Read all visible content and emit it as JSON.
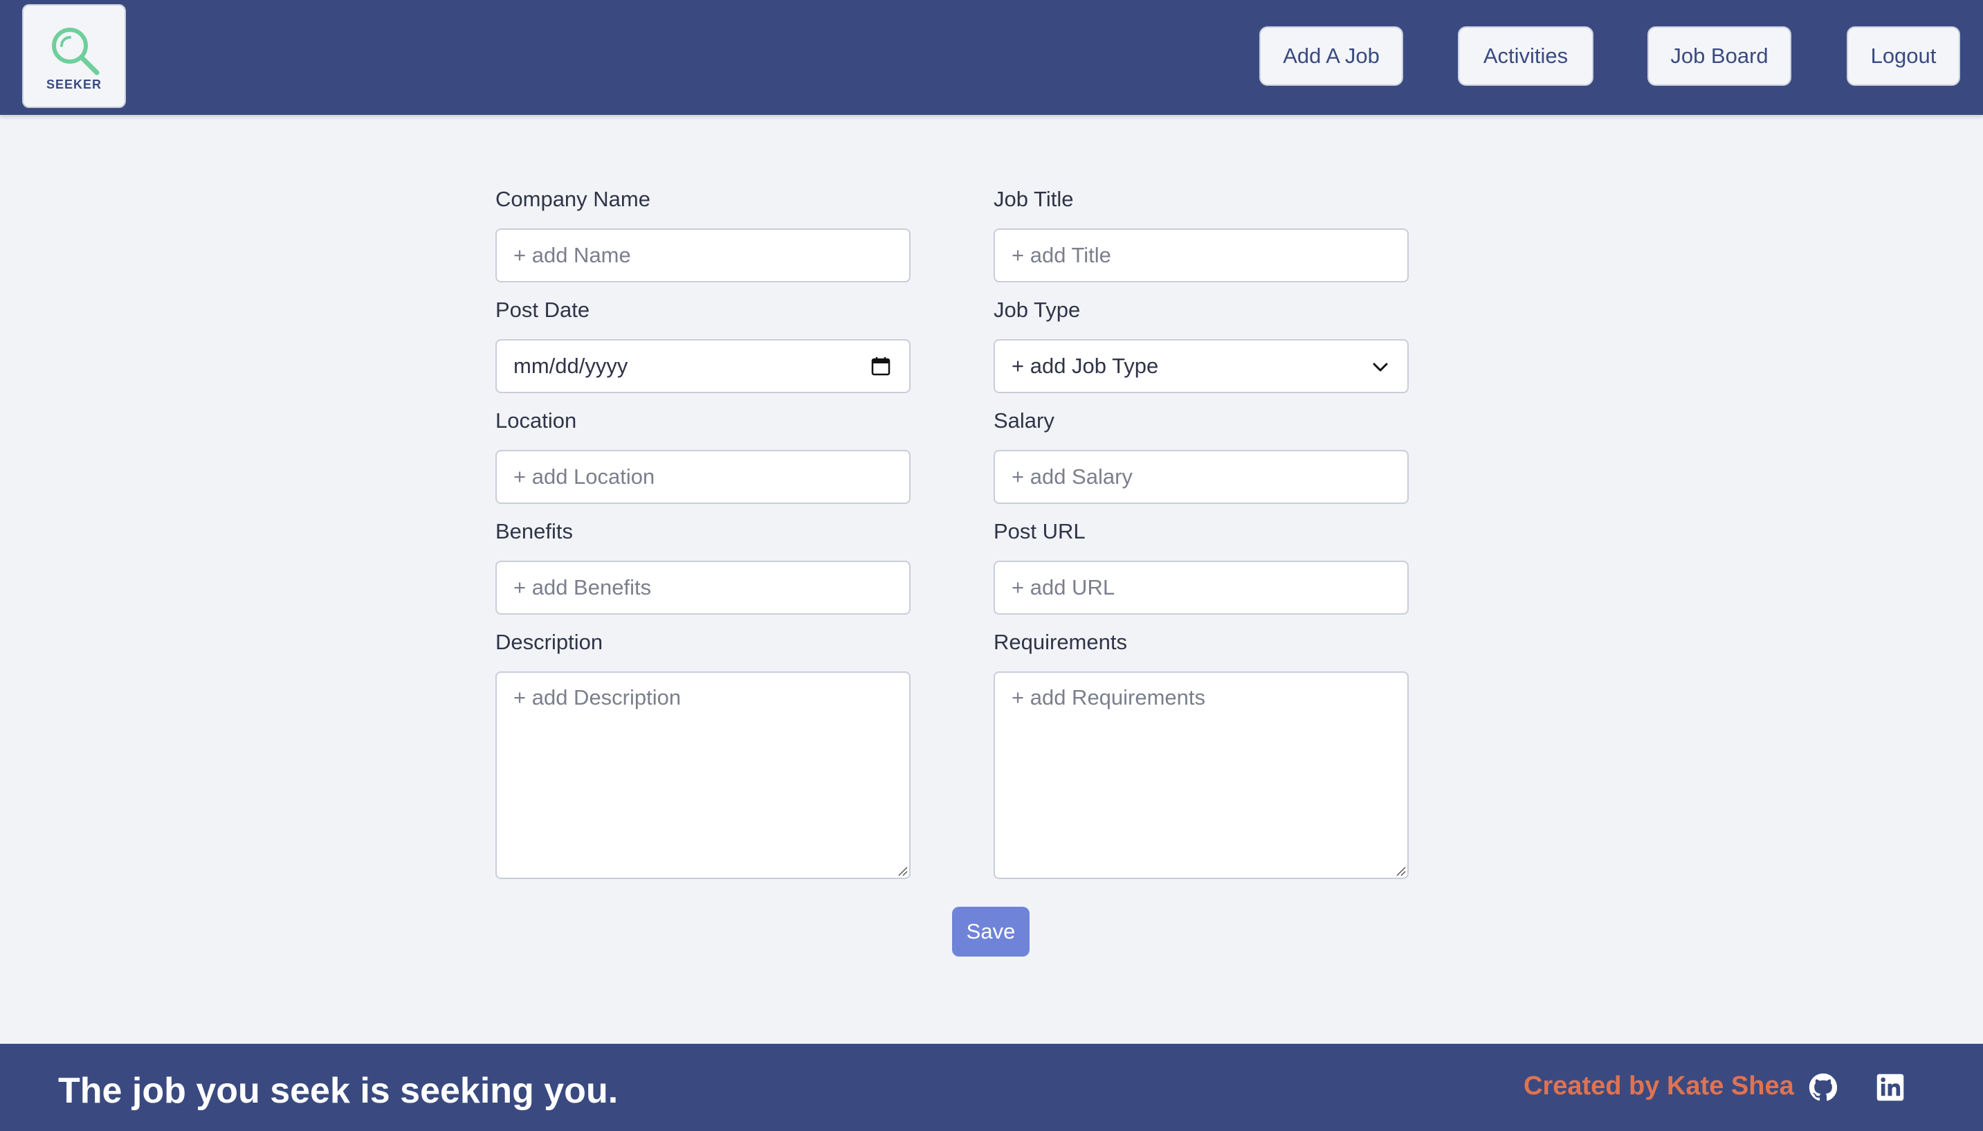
{
  "header": {
    "logo_text": "SEEKER",
    "nav": {
      "add_job": "Add A Job",
      "activities": "Activities",
      "job_board": "Job Board",
      "logout": "Logout"
    }
  },
  "form": {
    "company_name": {
      "label": "Company Name",
      "placeholder": "+ add Name"
    },
    "job_title": {
      "label": "Job Title",
      "placeholder": "+ add Title"
    },
    "post_date": {
      "label": "Post Date",
      "value": "mm/dd/yyyy"
    },
    "job_type": {
      "label": "Job Type",
      "selected": "+ add Job Type"
    },
    "location": {
      "label": "Location",
      "placeholder": "+ add Location"
    },
    "salary": {
      "label": "Salary",
      "placeholder": "+ add Salary"
    },
    "benefits": {
      "label": "Benefits",
      "placeholder": "+ add Benefits"
    },
    "post_url": {
      "label": "Post URL",
      "placeholder": "+ add URL"
    },
    "description": {
      "label": "Description",
      "placeholder": "+ add Description"
    },
    "requirements": {
      "label": "Requirements",
      "placeholder": "+ add Requirements"
    },
    "save_label": "Save"
  },
  "footer": {
    "tagline": "The job you seek is seeking you.",
    "credit": "Created by Kate Shea",
    "icons": [
      "github-icon",
      "linkedin-icon"
    ]
  },
  "colors": {
    "brand": "#3a4a80",
    "accent": "#6f84d9",
    "credit": "#e07350",
    "logo_green": "#6fcf9b",
    "background": "#f2f3f7"
  }
}
